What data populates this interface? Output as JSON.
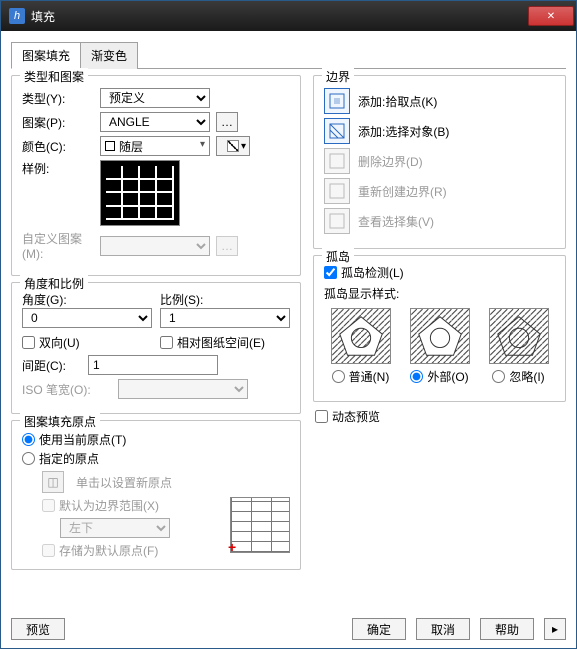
{
  "window": {
    "title": "填充"
  },
  "tabs": {
    "pattern": "图案填充",
    "gradient": "渐变色"
  },
  "groups": {
    "type_pattern": "类型和图案",
    "angle_scale": "角度和比例",
    "origin": "图案填充原点",
    "boundary": "边界",
    "islands": "孤岛"
  },
  "fields": {
    "type_label": "类型(Y):",
    "type_value": "预定义",
    "pattern_label": "图案(P):",
    "pattern_value": "ANGLE",
    "color_label": "颜色(C):",
    "color_value": "随层",
    "sample_label": "样例:",
    "custom_label": "自定义图案(M):",
    "angle_label": "角度(G):",
    "angle_value": "0",
    "scale_label": "比例(S):",
    "scale_value": "1",
    "bidir": "双向(U)",
    "paper_space": "相对图纸空间(E)",
    "spacing_label": "间距(C):",
    "spacing_value": "1",
    "iso_label": "ISO 笔宽(O):"
  },
  "origin": {
    "use_current": "使用当前原点(T)",
    "specified": "指定的原点",
    "click_set": "单击以设置新原点",
    "default_extent": "默认为边界范围(X)",
    "pos_value": "左下",
    "store_default": "存储为默认原点(F)"
  },
  "boundary": {
    "pick": "添加:拾取点(K)",
    "select": "添加:选择对象(B)",
    "remove": "删除边界(D)",
    "recreate": "重新创建边界(R)",
    "viewsel": "查看选择集(V)"
  },
  "islands": {
    "detect": "孤岛检测(L)",
    "style_label": "孤岛显示样式:",
    "normal": "普通(N)",
    "outer": "外部(O)",
    "ignore": "忽略(I)"
  },
  "dynamic_preview": "动态预览",
  "buttons": {
    "preview": "预览",
    "ok": "确定",
    "cancel": "取消",
    "help": "帮助"
  }
}
